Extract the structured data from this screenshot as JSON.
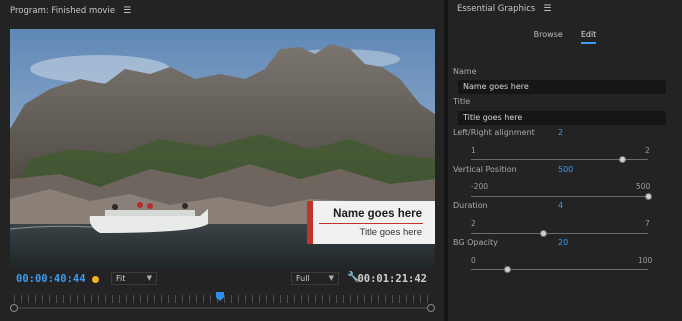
{
  "program_panel": {
    "title": "Program: Finished movie",
    "menu_icon": "hamburger-menu-icon",
    "overlay": {
      "name": "Name goes here",
      "title": "Title goes here",
      "accent_color": "#c0352b"
    },
    "current_timecode": "00:00:40:44",
    "fit_select": "Fit",
    "quality_select": "Full",
    "settings_icon": "wrench-icon",
    "duration_timecode": "00:01:21:42",
    "playhead_fraction": 0.49
  },
  "essential_graphics": {
    "title": "Essential Graphics",
    "menu_icon": "hamburger-menu-icon",
    "tabs": [
      {
        "label": "Browse",
        "active": false
      },
      {
        "label": "Edit",
        "active": true
      }
    ],
    "name_label": "Name",
    "name_value": "Name goes here",
    "title_label": "Title",
    "title_value": "Title goes here",
    "sliders": [
      {
        "label": "Left/Right alignment",
        "value": "2",
        "min": "1",
        "max": "2",
        "fraction": 0.85
      },
      {
        "label": "Vertical Position",
        "value": "500",
        "min": "-200",
        "max": "500",
        "fraction": 1.0
      },
      {
        "label": "Duration",
        "value": "4",
        "min": "2",
        "max": "7",
        "fraction": 0.4
      },
      {
        "label": "BG Opacity",
        "value": "20",
        "min": "0",
        "max": "100",
        "fraction": 0.2
      }
    ],
    "accent_color": "#3d9bf2"
  }
}
